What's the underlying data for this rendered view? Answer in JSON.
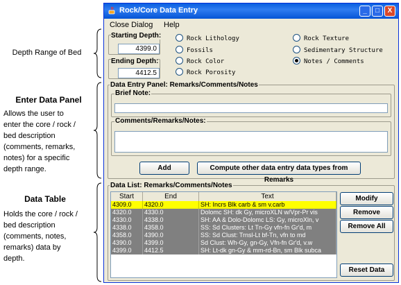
{
  "annotations": {
    "depth": {
      "label": "Depth Range of Bed"
    },
    "enter": {
      "heading": "Enter Data Panel",
      "lines": [
        "Allows the user to",
        "enter the core / rock /",
        "bed description",
        "(comments, remarks,",
        "notes) for a specific",
        "depth range."
      ]
    },
    "table": {
      "heading": "Data Table",
      "lines": [
        "Holds the core / rock /",
        "bed description",
        "(comments, notes,",
        "remarks) data by",
        "depth."
      ]
    }
  },
  "window": {
    "title": "Rock/Core Data Entry",
    "controls": {
      "minimize": "_",
      "maximize": "□",
      "close": "X"
    },
    "menu": [
      "Close Dialog",
      "Help"
    ]
  },
  "depth": {
    "starting_label": "Starting Depth:",
    "starting_value": "4399.0",
    "ending_label": "Ending Depth:",
    "ending_value": "4412.5"
  },
  "data_types": {
    "options": [
      "Rock Lithology",
      "Fossils",
      "Rock Color",
      "Rock Porosity",
      "Rock Texture",
      "Sedimentary Structure",
      "Notes / Comments"
    ],
    "selected": "Notes / Comments"
  },
  "entry_panel": {
    "title": "Data Entry Panel: Remarks/Comments/Notes",
    "brief_label": "Brief Note:",
    "brief_value": "",
    "comments_label": "Comments/Remarks/Notes:",
    "comments_value": "",
    "add_label": "Add",
    "compute_label": "Compute other data entry data types from Remarks"
  },
  "data_list": {
    "title": "Data List: Remarks/Comments/Notes",
    "columns": [
      "Start",
      "End",
      "Text"
    ],
    "rows": [
      [
        "4309.0",
        "4320.0",
        "SH: Incrs Blk carb & sm v.carb"
      ],
      [
        "4320.0",
        "4330.0",
        "Dolomc SH: dk Gy, microXLN w/Vpr-Pr vis"
      ],
      [
        "4330.0",
        "4338.0",
        "SH: AA & Dolo-Dolomc LS: Gy, microXln, v"
      ],
      [
        "4338.0",
        "4358.0",
        "SS: Sd Clusters: Lt Tn-Gy vfn-fn Gr'd, m"
      ],
      [
        "4358.0",
        "4390.0",
        "SS: Sd Clust: Trnsl-Lt bf-Tn, vfn to md"
      ],
      [
        "4390.0",
        "4399.0",
        "Sd Clust: Wh-Gy, gn-Gy, Vfn-fn Gr'd, v.w"
      ],
      [
        "4399.0",
        "4412.5",
        "SH: Lt-dk gn-Gy & mm-rd-Bn, sm Blk subca"
      ]
    ],
    "selected_row": 0,
    "buttons": {
      "modify": "Modify",
      "remove": "Remove",
      "remove_all": "Remove All",
      "reset": "Reset Data"
    }
  },
  "colors": {
    "title_bar": "#0a5fe0",
    "selected_row": "#ffff00",
    "row_bg": "#808080",
    "window_bg": "#ece9d8"
  }
}
